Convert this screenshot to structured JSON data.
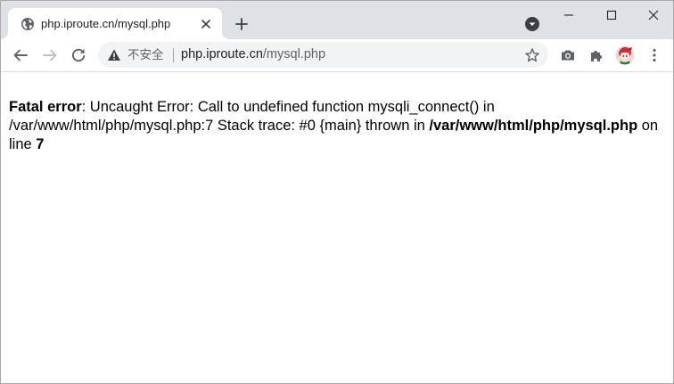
{
  "browser": {
    "tab": {
      "title": "php.iproute.cn/mysql.php"
    },
    "omnibox": {
      "security_label": "不安全",
      "url_host": "php.iproute.cn",
      "url_path": "/mysql.php"
    },
    "icons": {
      "favicon": "globe-icon",
      "tab_close": "close-icon",
      "new_tab": "plus-icon",
      "tab_search": "chevron-down-circle-icon",
      "back": "arrow-left-icon",
      "forward": "arrow-right-icon",
      "reload": "reload-icon",
      "security": "warning-triangle-icon",
      "bookmark": "star-icon",
      "screenshot": "camera-icon",
      "extensions": "puzzle-icon",
      "profile": "avatar",
      "menu": "kebab-menu-icon"
    }
  },
  "page": {
    "error_label": "Fatal error",
    "error_message": ": Uncaught Error: Call to undefined function mysqli_connect() in /var/www/html/php/mysql.php:7 Stack trace: #0 {main} thrown in ",
    "error_file": "/var/www/html/php/mysql.php",
    "on_line_text": " on line ",
    "line_number": "7"
  }
}
